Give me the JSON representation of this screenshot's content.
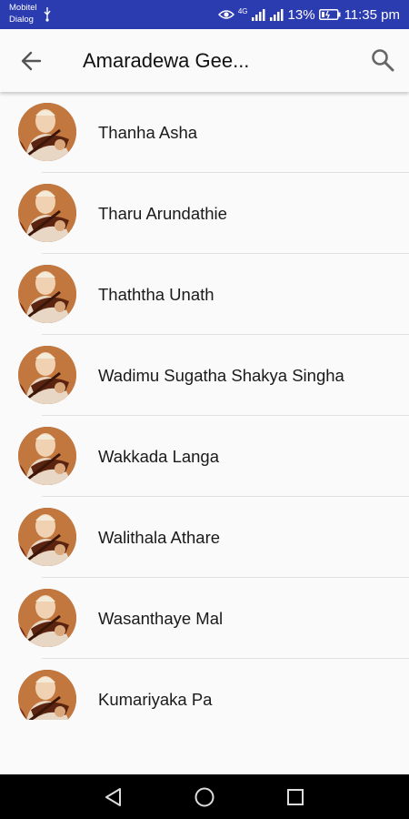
{
  "status_bar": {
    "carrier_line1": "Mobitel",
    "carrier_line2": "Dialog",
    "network_label": "4G",
    "battery": "13%",
    "time": "11:35 pm"
  },
  "app_bar": {
    "title": "Amaradewa Gee..."
  },
  "songs": [
    {
      "title": "Thanha Asha"
    },
    {
      "title": "Tharu Arundathie"
    },
    {
      "title": "Thaththa Unath"
    },
    {
      "title": "Wadimu Sugatha Shakya Singha"
    },
    {
      "title": "Wakkada Langa"
    },
    {
      "title": "Walithala Athare"
    },
    {
      "title": "Wasanthaye Mal"
    },
    {
      "title": "Kumariyaka Pa"
    }
  ],
  "colors": {
    "status_bar": "#2b3bb0",
    "background": "#fafafa",
    "nav_bar": "#000000"
  },
  "icons": {
    "back": "arrow-left-icon",
    "search": "search-icon",
    "nav_back": "triangle-back-icon",
    "nav_home": "circle-home-icon",
    "nav_recents": "square-recents-icon"
  }
}
